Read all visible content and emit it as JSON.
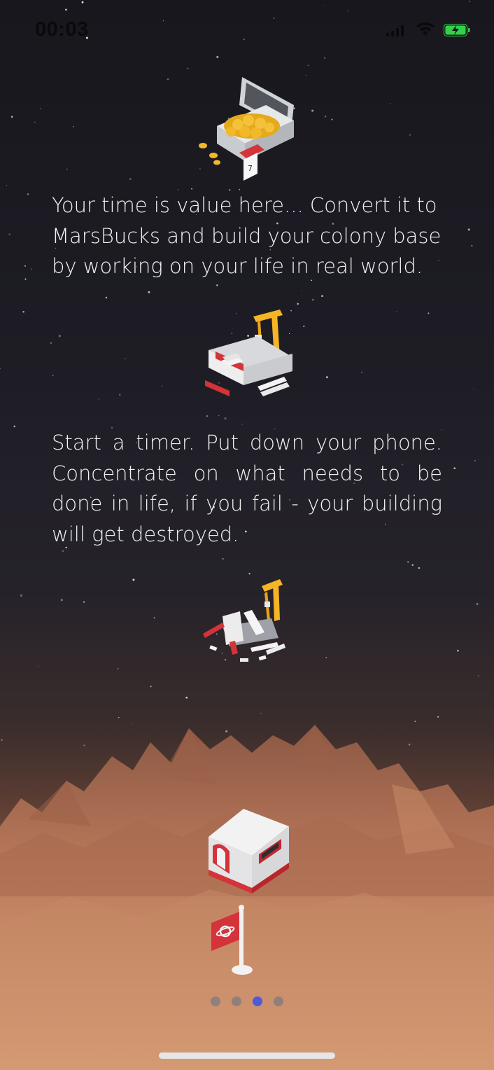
{
  "status_bar": {
    "time": "00:03",
    "icons": [
      "signal-icon",
      "wifi-icon",
      "battery-charging-icon"
    ],
    "battery_color": "#33d14a"
  },
  "onboarding": {
    "paragraphs": [
      "Your time is value here... Convert it to MarsBucks and build your colony base by working on your life in real world.",
      "Start a timer. Put down your phone. Concentrate on what needs to be done in life, if you fail - your building will get destroyed."
    ],
    "illustrations": [
      "coin-briefcase-icon",
      "construction-site-icon",
      "destroyed-building-icon",
      "mars-base-icon",
      "planet-flag-icon"
    ]
  },
  "pagination": {
    "count": 4,
    "active_index": 2,
    "active_color": "#4d5bd8"
  }
}
